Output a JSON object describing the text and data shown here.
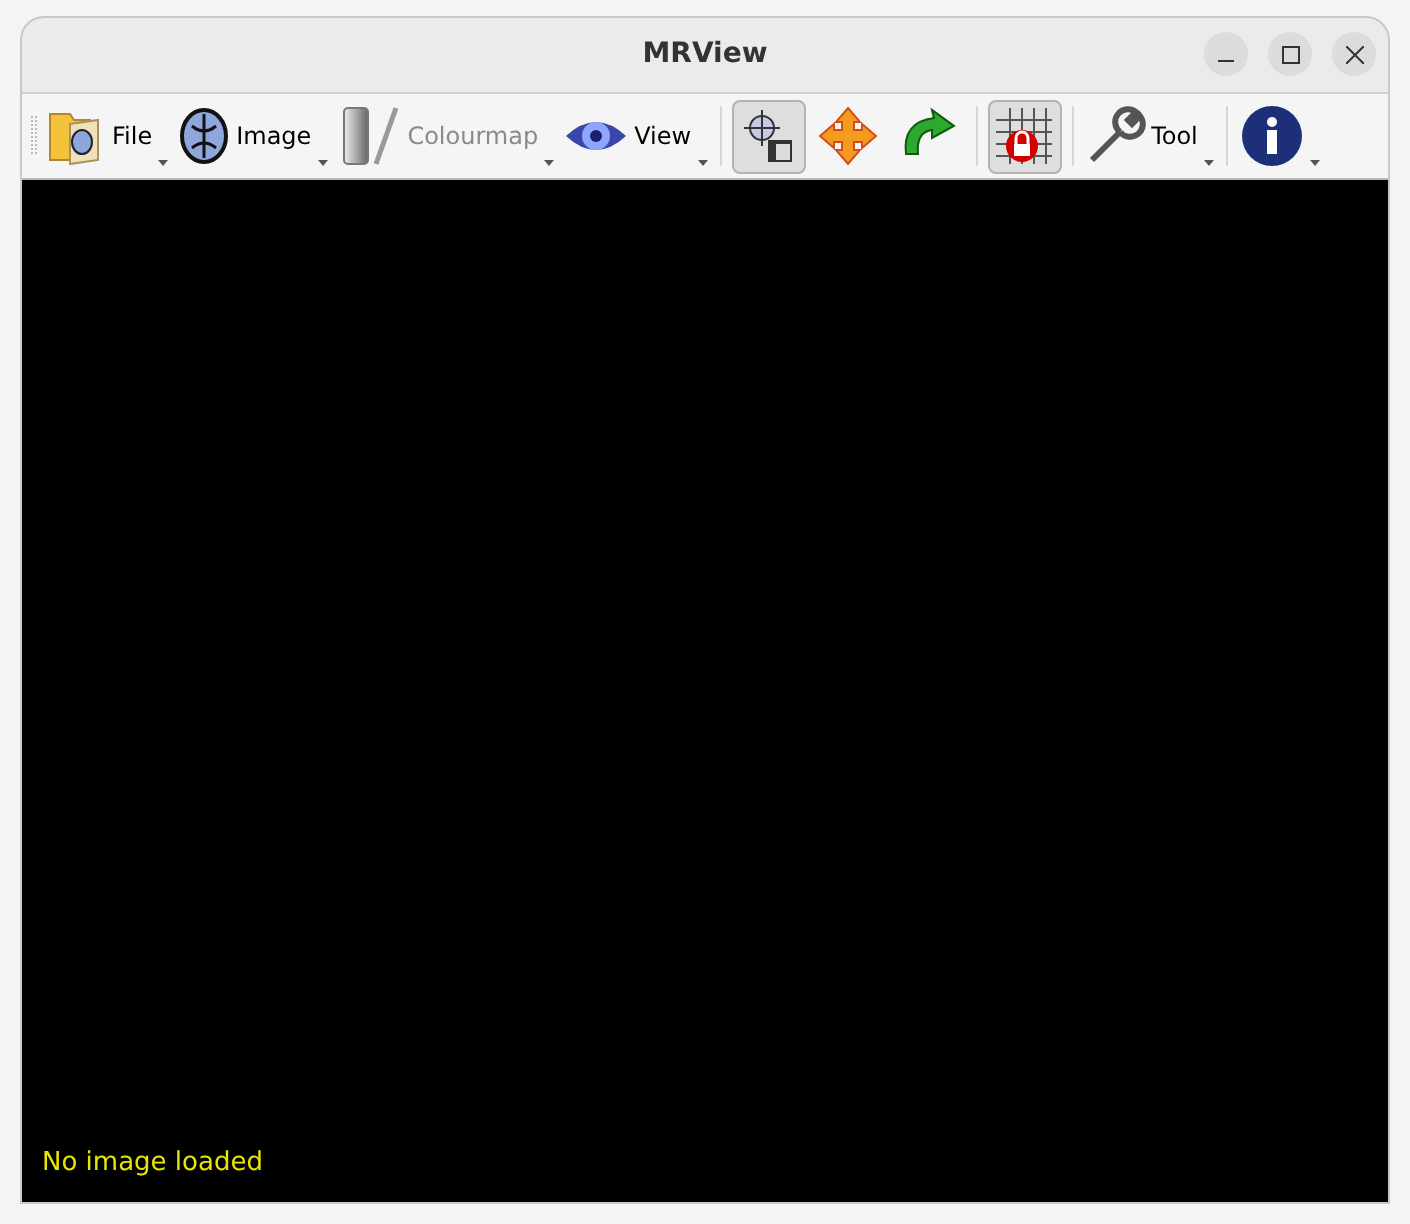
{
  "window": {
    "title": "MRView"
  },
  "toolbar": [
    {
      "kind": "menu",
      "label": "File",
      "disabled": false
    },
    {
      "kind": "menu",
      "label": "Image",
      "disabled": false
    },
    {
      "kind": "menu",
      "label": "Colourmap",
      "disabled": true
    },
    {
      "kind": "menu",
      "label": "View",
      "disabled": false
    },
    {
      "kind": "separator"
    },
    {
      "kind": "tool",
      "selected": true
    },
    {
      "kind": "tool",
      "selected": false
    },
    {
      "kind": "tool",
      "selected": false
    },
    {
      "kind": "separator"
    },
    {
      "kind": "tool",
      "selected": true
    },
    {
      "kind": "separator"
    },
    {
      "kind": "menu",
      "label": "Tool",
      "disabled": false
    },
    {
      "kind": "separator"
    },
    {
      "kind": "menu",
      "disabled": false
    }
  ],
  "viewport": {
    "status": "No image loaded"
  }
}
